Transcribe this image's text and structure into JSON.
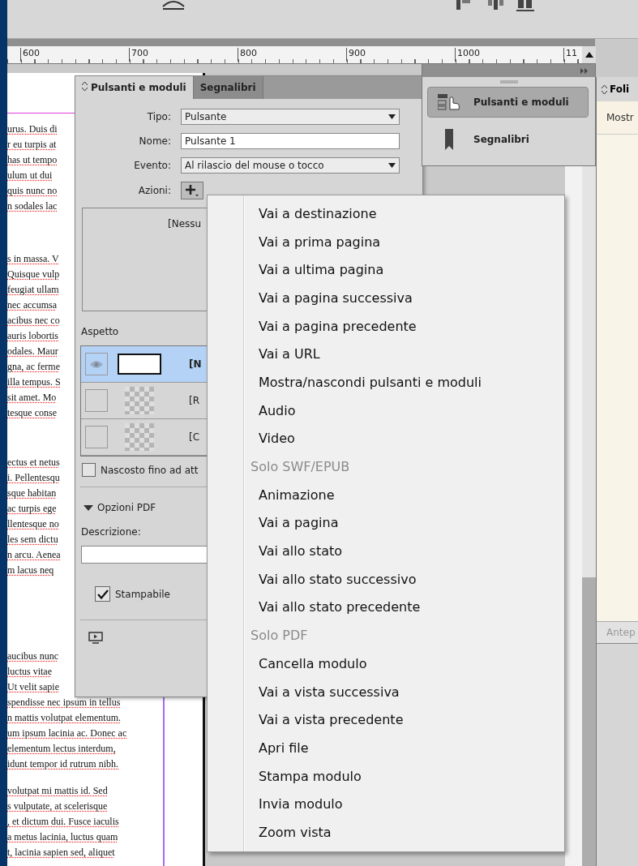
{
  "ruler": {
    "labels": [
      "600",
      "700",
      "800",
      "900",
      "1000",
      "11"
    ]
  },
  "document": {
    "paragraphs": [
      [
        "urus. Duis di",
        "r eu turpis at",
        "has ut tempo",
        "ulum ut dui",
        "quis nunc no",
        "n sodales lac"
      ],
      [
        "s in massa. V",
        "Quisque vulp",
        "feugiat ullam",
        "nec accumsa",
        "acibus nec co",
        "auris lobortis",
        "odales. Maur",
        "gna, ac ferme",
        "illa tempus. S",
        "sit amet. Mo",
        "tesque conse"
      ],
      [
        "ectus et netus",
        "i. Pellentesqu",
        "sque habitan",
        "ac turpis ege",
        "llentesque no",
        "les sem dictu",
        "n arcu. Aenea",
        "m lacus neq"
      ],
      [
        "aucibus nunc",
        "luctus vitae",
        "Ut velit sapie",
        "spendisse nec ipsum in tellus",
        "n mattis volutpat elementum.",
        "um ipsum lacinia ac. Donec ac",
        "elementum lectus interdum,",
        "idunt tempor id rutrum nibh."
      ],
      [
        "volutpat mi mattis id. Sed",
        "s vulputate, at scelerisque",
        ", et dictum dui. Fusce iaculis",
        "a metus lacinia, luctus quam",
        "t, lacinia sapien sed, aliquet"
      ]
    ]
  },
  "buttons_panel": {
    "tabs": [
      {
        "label": "Pulsanti e moduli",
        "selected": true
      },
      {
        "label": "Segnalibri",
        "selected": false
      }
    ],
    "fields": [
      {
        "kind": "dropdown",
        "label": "Tipo:",
        "value": "Pulsante"
      },
      {
        "kind": "input",
        "label": "Nome:",
        "value": "Pulsante 1"
      },
      {
        "kind": "dropdown",
        "label": "Evento:",
        "value": "Al rilascio del mouse o tocco"
      }
    ],
    "actions_label": "Azioni:",
    "actions_list": "[Nessu",
    "appearance_label": "Aspetto",
    "appearance": [
      {
        "label": "[N",
        "selected": true,
        "visible": true,
        "kind": "white"
      },
      {
        "label": "[R",
        "selected": false,
        "visible": false,
        "kind": "checker"
      },
      {
        "label": "[C",
        "selected": false,
        "visible": false,
        "kind": "checker"
      }
    ],
    "hidden_until": {
      "label": "Nascosto fino ad att",
      "checked": false
    },
    "pdf_options": {
      "label": "Opzioni PDF",
      "expanded": true
    },
    "description_label": "Descrizione:",
    "printable": {
      "label": "Stampabile",
      "checked": true
    }
  },
  "panel_dock": {
    "items": [
      {
        "label": "Pulsanti e moduli",
        "selected": true,
        "kind": "buttons"
      },
      {
        "label": "Segnalibri",
        "selected": false,
        "kind": "bookmark"
      }
    ]
  },
  "folio_panel": {
    "title": "Foli",
    "button": "Mostr",
    "preview": "Antep"
  },
  "menu": {
    "items": [
      {
        "kind": "item",
        "label": "Vai a destinazione"
      },
      {
        "kind": "item",
        "label": "Vai a prima pagina"
      },
      {
        "kind": "item",
        "label": "Vai a ultima pagina"
      },
      {
        "kind": "item",
        "label": "Vai a pagina successiva"
      },
      {
        "kind": "item",
        "label": "Vai a pagina precedente"
      },
      {
        "kind": "item",
        "label": "Vai a URL"
      },
      {
        "kind": "item",
        "label": "Mostra/nascondi pulsanti e moduli"
      },
      {
        "kind": "item",
        "label": "Audio"
      },
      {
        "kind": "item",
        "label": "Video"
      },
      {
        "kind": "header",
        "label": "Solo SWF/EPUB"
      },
      {
        "kind": "item",
        "label": "Animazione"
      },
      {
        "kind": "item",
        "label": "Vai a pagina"
      },
      {
        "kind": "item",
        "label": "Vai allo stato"
      },
      {
        "kind": "item",
        "label": "Vai allo stato successivo"
      },
      {
        "kind": "item",
        "label": "Vai allo stato precedente"
      },
      {
        "kind": "header",
        "label": "Solo PDF"
      },
      {
        "kind": "item",
        "label": "Cancella modulo"
      },
      {
        "kind": "item",
        "label": "Vai a vista successiva"
      },
      {
        "kind": "item",
        "label": "Vai a vista precedente"
      },
      {
        "kind": "item",
        "label": "Apri file"
      },
      {
        "kind": "item",
        "label": "Stampa modulo"
      },
      {
        "kind": "item",
        "label": "Invia modulo"
      },
      {
        "kind": "item",
        "label": "Zoom vista"
      }
    ]
  }
}
